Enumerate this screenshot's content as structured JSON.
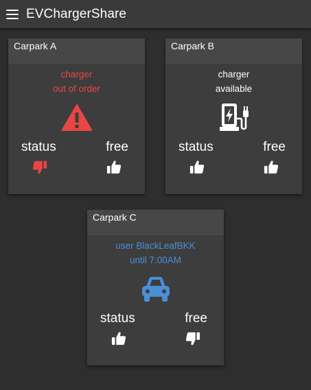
{
  "app": {
    "title": "EVChargerShare"
  },
  "cards": [
    {
      "name": "Carpark A",
      "message_line1": "charger",
      "message_line2": "out of order",
      "icon": "warning-icon",
      "status_label": "status",
      "free_label": "free",
      "status_vote": "thumb-down-icon",
      "free_vote": "thumb-up-icon"
    },
    {
      "name": "Carpark B",
      "message_line1": "charger",
      "message_line2": "available",
      "icon": "ev-charger-icon",
      "status_label": "status",
      "free_label": "free",
      "status_vote": "thumb-up-icon",
      "free_vote": "thumb-up-icon"
    },
    {
      "name": "Carpark C",
      "message_line1": "user BlackLeafBKK",
      "message_line2": "until 7:00AM",
      "icon": "car-icon",
      "status_label": "status",
      "free_label": "free",
      "status_vote": "thumb-up-icon",
      "free_vote": "thumb-down-icon"
    }
  ],
  "colors": {
    "background": "#2e2e2e",
    "card": "#3d3d3d",
    "card_header": "#474747",
    "danger": "#e84545",
    "info": "#4a8fd6",
    "text": "#ffffff"
  }
}
